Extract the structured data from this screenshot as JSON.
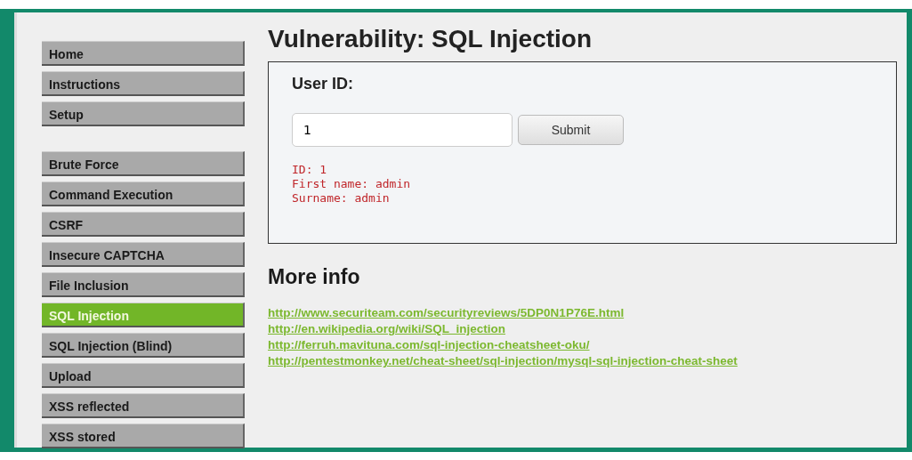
{
  "sidebar": {
    "groups": [
      {
        "items": [
          {
            "label": "Home",
            "selected": false
          },
          {
            "label": "Instructions",
            "selected": false
          },
          {
            "label": "Setup",
            "selected": false
          }
        ]
      },
      {
        "items": [
          {
            "label": "Brute Force",
            "selected": false
          },
          {
            "label": "Command Execution",
            "selected": false
          },
          {
            "label": "CSRF",
            "selected": false
          },
          {
            "label": "Insecure CAPTCHA",
            "selected": false
          },
          {
            "label": "File Inclusion",
            "selected": false
          },
          {
            "label": "SQL Injection",
            "selected": true
          },
          {
            "label": "SQL Injection (Blind)",
            "selected": false
          },
          {
            "label": "Upload",
            "selected": false
          },
          {
            "label": "XSS reflected",
            "selected": false
          },
          {
            "label": "XSS stored",
            "selected": false
          }
        ]
      }
    ]
  },
  "main": {
    "title": "Vulnerability: SQL Injection",
    "form": {
      "label": "User ID:",
      "value": "1",
      "button": "Submit",
      "result": [
        "ID: 1",
        "First name: admin",
        "Surname: admin"
      ]
    },
    "more_info": {
      "heading": "More info",
      "links": [
        "http://www.securiteam.com/securityreviews/5DP0N1P76E.html",
        "http://en.wikipedia.org/wiki/SQL_injection",
        "http://ferruh.mavituna.com/sql-injection-cheatsheet-oku/",
        "http://pentestmonkey.net/cheat-sheet/sql-injection/mysql-sql-injection-cheat-sheet"
      ]
    }
  }
}
